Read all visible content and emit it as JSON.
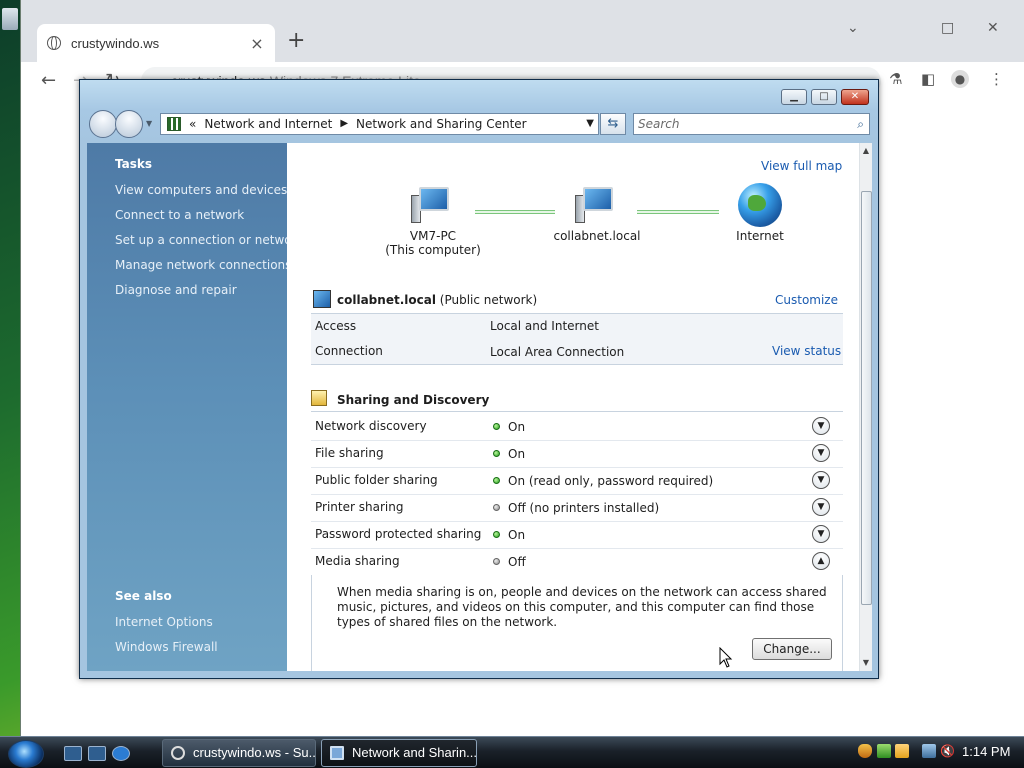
{
  "browser": {
    "tab_title": "crustywindo.ws",
    "tab_close": "×",
    "new_tab": "+",
    "url_host": "crustywindo.ws",
    "url_rest": "Windows 7 Extreme Lite",
    "controls": {
      "minimize": "⌄",
      "restore": "□",
      "close": "✕"
    }
  },
  "explorer": {
    "breadcrumb": {
      "prefix": "«",
      "part1": "Network and Internet",
      "part2": "Network and Sharing Center"
    },
    "search_placeholder": "Search",
    "tasks": {
      "heading": "Tasks",
      "items": [
        "View computers and devices",
        "Connect to a network",
        "Set up a connection or network",
        "Manage network connections",
        "Diagnose and repair"
      ]
    },
    "see_also": {
      "heading": "See also",
      "items": [
        "Internet Options",
        "Windows Firewall"
      ]
    },
    "view_full_map": "View full map",
    "map": {
      "computer_name": "VM7-PC",
      "computer_sub": "(This computer)",
      "network_name": "collabnet.local",
      "internet": "Internet"
    },
    "network": {
      "name": "collabnet.local",
      "type": "(Public network)",
      "customize": "Customize",
      "access_label": "Access",
      "access_value": "Local and Internet",
      "connection_label": "Connection",
      "connection_value": "Local Area Connection",
      "view_status": "View status"
    },
    "sharing": {
      "title": "Sharing and Discovery",
      "rows": [
        {
          "label": "Network discovery",
          "state": "On",
          "on": true,
          "expanded": false
        },
        {
          "label": "File sharing",
          "state": "On",
          "on": true,
          "expanded": false
        },
        {
          "label": "Public folder sharing",
          "state": "On (read only, password required)",
          "on": true,
          "expanded": false
        },
        {
          "label": "Printer sharing",
          "state": "Off (no printers installed)",
          "on": false,
          "expanded": false
        },
        {
          "label": "Password protected sharing",
          "state": "On",
          "on": true,
          "expanded": false
        },
        {
          "label": "Media sharing",
          "state": "Off",
          "on": false,
          "expanded": true
        }
      ],
      "media_desc": "When media sharing is on, people and devices on the network can access shared music, pictures, and videos on this computer, and this computer can find those types of shared files on the network.",
      "change_button": "Change..."
    }
  },
  "taskbar": {
    "buttons": [
      {
        "label": "crustywindo.ws - Su..."
      },
      {
        "label": "Network and Sharin..."
      }
    ],
    "clock": "1:14 PM"
  }
}
